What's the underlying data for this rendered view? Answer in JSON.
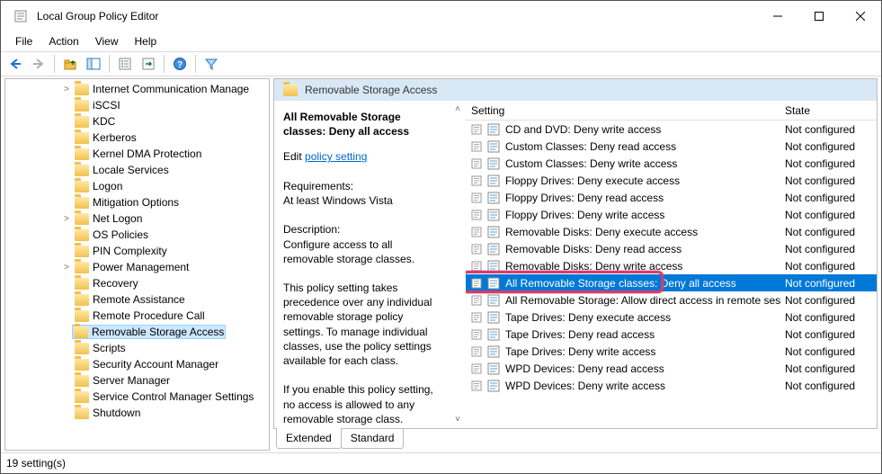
{
  "window": {
    "title": "Local Group Policy Editor"
  },
  "menu": {
    "items": [
      "File",
      "Action",
      "View",
      "Help"
    ]
  },
  "tree": {
    "items": [
      {
        "indent": 4,
        "caret": ">",
        "label": "Internet Communication Manage"
      },
      {
        "indent": 4,
        "caret": "",
        "label": "iSCSI"
      },
      {
        "indent": 4,
        "caret": "",
        "label": "KDC"
      },
      {
        "indent": 4,
        "caret": "",
        "label": "Kerberos"
      },
      {
        "indent": 4,
        "caret": "",
        "label": "Kernel DMA Protection"
      },
      {
        "indent": 4,
        "caret": "",
        "label": "Locale Services"
      },
      {
        "indent": 4,
        "caret": "",
        "label": "Logon"
      },
      {
        "indent": 4,
        "caret": "",
        "label": "Mitigation Options"
      },
      {
        "indent": 4,
        "caret": ">",
        "label": "Net Logon"
      },
      {
        "indent": 4,
        "caret": "",
        "label": "OS Policies"
      },
      {
        "indent": 4,
        "caret": "",
        "label": "PIN Complexity"
      },
      {
        "indent": 4,
        "caret": ">",
        "label": "Power Management"
      },
      {
        "indent": 4,
        "caret": "",
        "label": "Recovery"
      },
      {
        "indent": 4,
        "caret": "",
        "label": "Remote Assistance"
      },
      {
        "indent": 4,
        "caret": "",
        "label": "Remote Procedure Call"
      },
      {
        "indent": 4,
        "caret": "",
        "label": "Removable Storage Access",
        "selected": true
      },
      {
        "indent": 4,
        "caret": "",
        "label": "Scripts"
      },
      {
        "indent": 4,
        "caret": "",
        "label": "Security Account Manager"
      },
      {
        "indent": 4,
        "caret": "",
        "label": "Server Manager"
      },
      {
        "indent": 4,
        "caret": "",
        "label": "Service Control Manager Settings"
      },
      {
        "indent": 4,
        "caret": "",
        "label": "Shutdown"
      }
    ]
  },
  "pane": {
    "header": "Removable Storage Access",
    "policy_title": "All Removable Storage classes: Deny all access",
    "edit_prefix": "Edit ",
    "edit_link": "policy setting",
    "req_label": "Requirements:",
    "req_text": "At least Windows Vista",
    "desc_label": "Description:",
    "desc_text1": "Configure access to all removable storage classes.",
    "desc_text2": "This policy setting takes precedence over any individual removable storage policy settings. To manage individual classes, use the policy settings available for each class.",
    "desc_text3": "If you enable this policy setting, no access is allowed to any removable storage class."
  },
  "columns": {
    "setting": "Setting",
    "state": "State"
  },
  "settings": [
    {
      "name": "CD and DVD: Deny write access",
      "state": "Not configured"
    },
    {
      "name": "Custom Classes: Deny read access",
      "state": "Not configured"
    },
    {
      "name": "Custom Classes: Deny write access",
      "state": "Not configured"
    },
    {
      "name": "Floppy Drives: Deny execute access",
      "state": "Not configured"
    },
    {
      "name": "Floppy Drives: Deny read access",
      "state": "Not configured"
    },
    {
      "name": "Floppy Drives: Deny write access",
      "state": "Not configured"
    },
    {
      "name": "Removable Disks: Deny execute access",
      "state": "Not configured"
    },
    {
      "name": "Removable Disks: Deny read access",
      "state": "Not configured"
    },
    {
      "name": "Removable Disks: Deny write access",
      "state": "Not configured"
    },
    {
      "name": "All Removable Storage classes: Deny all access",
      "state": "Not configured",
      "selected": true,
      "highlighted": true
    },
    {
      "name": "All Removable Storage: Allow direct access in remote sessions",
      "state": "Not configured"
    },
    {
      "name": "Tape Drives: Deny execute access",
      "state": "Not configured"
    },
    {
      "name": "Tape Drives: Deny read access",
      "state": "Not configured"
    },
    {
      "name": "Tape Drives: Deny write access",
      "state": "Not configured"
    },
    {
      "name": "WPD Devices: Deny read access",
      "state": "Not configured"
    },
    {
      "name": "WPD Devices: Deny write access",
      "state": "Not configured"
    }
  ],
  "tabs": {
    "extended": "Extended",
    "standard": "Standard"
  },
  "status": "19 setting(s)"
}
